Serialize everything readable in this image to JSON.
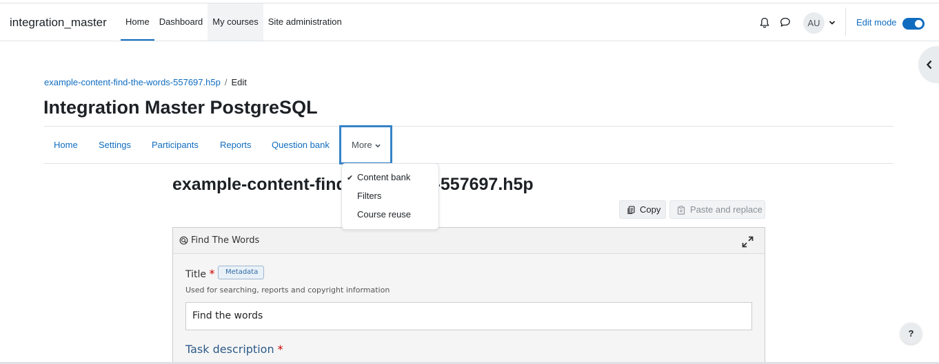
{
  "navbar": {
    "site_name": "integration_master",
    "items": [
      {
        "label": "Home"
      },
      {
        "label": "Dashboard"
      },
      {
        "label": "My courses"
      },
      {
        "label": "Site administration"
      }
    ],
    "avatar_initials": "AU",
    "edit_mode_label": "Edit mode",
    "edit_mode_on": true
  },
  "breadcrumb": {
    "link": "example-content-find-the-words-557697.h5p",
    "separator": "/",
    "current": "Edit"
  },
  "page_title": "Integration Master PostgreSQL",
  "secondary_nav": {
    "items": [
      "Home",
      "Settings",
      "Participants",
      "Reports",
      "Question bank"
    ],
    "more_label": "More"
  },
  "more_menu": {
    "items": [
      {
        "label": "Content bank",
        "checked": true
      },
      {
        "label": "Filters",
        "checked": false
      },
      {
        "label": "Course reuse",
        "checked": false
      }
    ]
  },
  "content_title": "example-content-find-the-words-557697.h5p",
  "actions": {
    "copy_label": "Copy",
    "paste_label": "Paste and replace"
  },
  "editor": {
    "library_name": "Find The Words",
    "title_label": "Title",
    "required_mark": "*",
    "metadata_label": "Metadata",
    "title_description": "Used for searching, reports and copyright information",
    "title_value": "Find the words",
    "task_label": "Task description"
  },
  "help_label": "?",
  "colors": {
    "primary": "#0f6cbf",
    "text": "#1d2125",
    "required": "#cc0000",
    "focus_border": "#3582c7"
  }
}
